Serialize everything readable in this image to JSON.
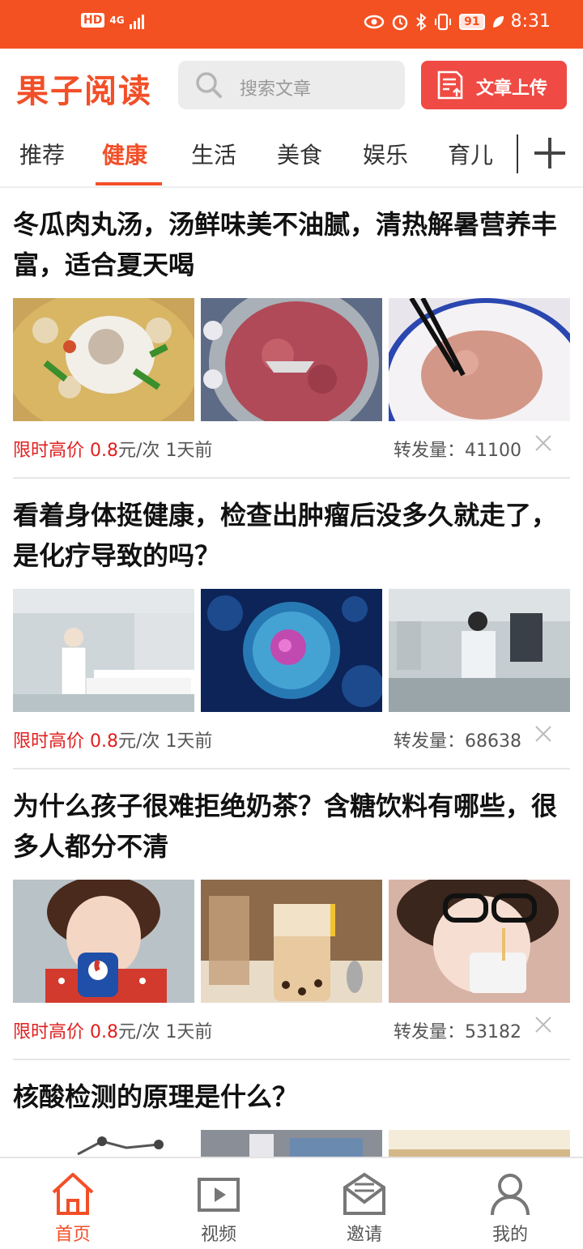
{
  "status_bar": {
    "hd": "HD",
    "network": "4G",
    "battery": "91",
    "time": "8:31"
  },
  "header": {
    "logo": "果子阅读",
    "search_placeholder": "搜索文章",
    "upload_label": "文章上传"
  },
  "tabs": [
    "推荐",
    "健康",
    "生活",
    "美食",
    "娱乐",
    "育儿"
  ],
  "active_tab": "健康",
  "articles": [
    {
      "title": "冬瓜肉丸汤，汤鲜味美不油腻，清热解暑营养丰富，适合夏天喝",
      "price_label": "限时高价",
      "price_value": "0.8",
      "price_unit": "元/次",
      "time": "1天前",
      "share_label": "转发量：",
      "share_count": "41100"
    },
    {
      "title": "看着身体挺健康，检查出肿瘤后没多久就走了，是化疗导致的吗？",
      "price_label": "限时高价",
      "price_value": "0.8",
      "price_unit": "元/次",
      "time": "1天前",
      "share_label": "转发量：",
      "share_count": "68638"
    },
    {
      "title": "为什么孩子很难拒绝奶茶？含糖饮料有哪些，很多人都分不清",
      "price_label": "限时高价",
      "price_value": "0.8",
      "price_unit": "元/次",
      "time": "1天前",
      "share_label": "转发量：",
      "share_count": "53182"
    },
    {
      "title": "核酸检测的原理是什么？"
    }
  ],
  "bottom_nav": [
    "首页",
    "视频",
    "邀请",
    "我的"
  ],
  "colors": {
    "brand": "#f24f28",
    "status_bar": "#f45122",
    "upload_button": "#ef4a43",
    "price": "#e02020"
  }
}
